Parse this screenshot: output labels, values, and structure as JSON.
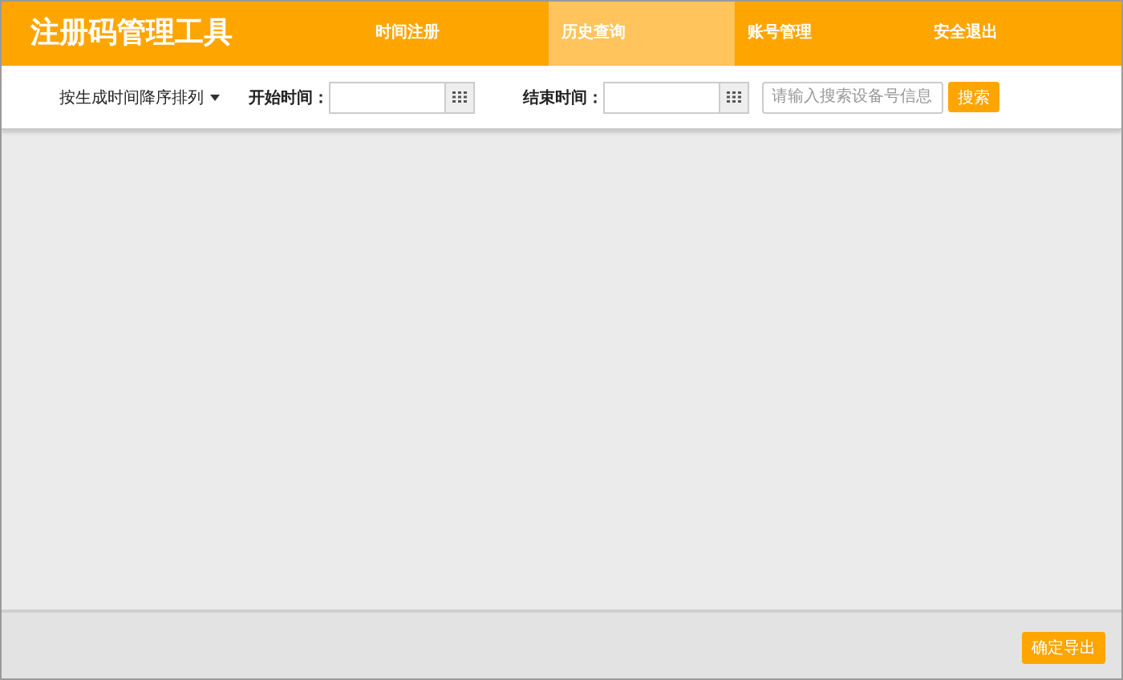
{
  "app_title": "注册码管理工具",
  "nav": [
    {
      "label": "时间注册",
      "selected": false
    },
    {
      "label": "历史查询",
      "selected": true
    },
    {
      "label": "账号管理",
      "selected": false
    },
    {
      "label": "安全退出",
      "selected": false
    }
  ],
  "sort": {
    "label": "按生成时间降序排列"
  },
  "start": {
    "label": "开始时间："
  },
  "end": {
    "label": "结束时间："
  },
  "search": {
    "placeholder": "请输入搜索设备号信息",
    "button": "搜索"
  },
  "footer": {
    "button": "确定导出"
  }
}
